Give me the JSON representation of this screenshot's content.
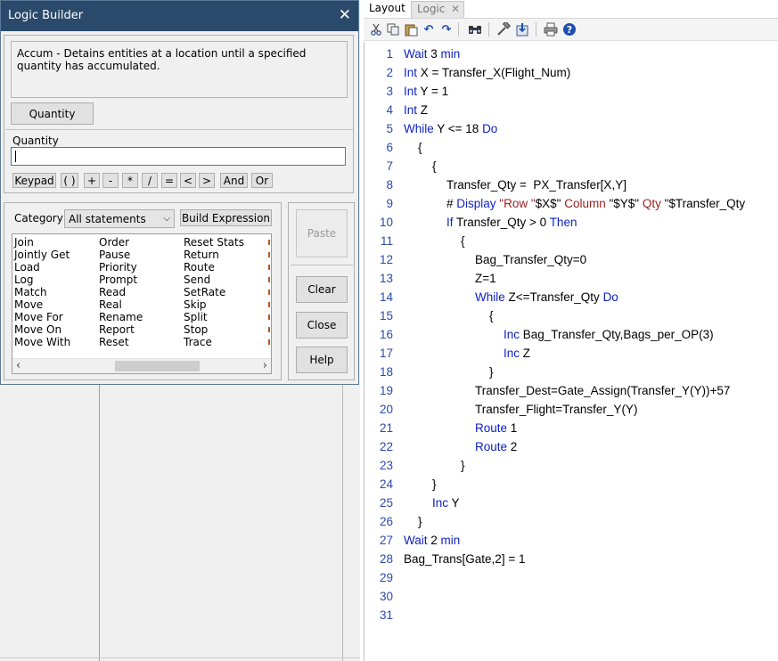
{
  "dialog": {
    "title": "Logic Builder",
    "close_glyph": "✕",
    "description": "Accum - Detains entities at a location until a specified quantity has accumulated.",
    "param_button": "Quantity",
    "quantity_label": "Quantity",
    "quantity_value": "",
    "keypad_buttons": [
      "Keypad",
      "( )",
      "+",
      "-",
      "*",
      "/",
      "=",
      "<",
      ">",
      "And",
      "Or"
    ],
    "category_label": "Category",
    "category_selected": "All statements",
    "build_expression": "Build Expression",
    "side_buttons": {
      "paste": "Paste",
      "clear": "Clear",
      "close": "Close",
      "help": "Help"
    },
    "statements_columns": [
      [
        "Join",
        "Jointly Get",
        "Load",
        "Log",
        "Match",
        "Move",
        "Move For",
        "Move On",
        "Move With"
      ],
      [
        "Order",
        "Pause",
        "Priority",
        "Prompt",
        "Read",
        "Real",
        "Rename",
        "Report",
        "Reset"
      ],
      [
        "Reset Stats",
        "Return",
        "Route",
        "Send",
        "SetRate",
        "Skip",
        "Split",
        "Stop",
        "Trace"
      ]
    ]
  },
  "tabs": [
    {
      "label": "Layout",
      "active": true
    },
    {
      "label": "Logic",
      "active": false,
      "close": "✕"
    }
  ],
  "toolbar": [
    "cut-icon",
    "copy-icon",
    "paste-icon",
    "undo-icon",
    "redo-icon",
    "find-icon",
    "build-icon",
    "import-icon",
    "print-icon",
    "help-icon"
  ],
  "editor": {
    "line_numbers": [
      "1",
      "2",
      "3",
      "4",
      "5",
      "6",
      "7",
      "8",
      "9",
      "10",
      "11",
      "12",
      "13",
      "14",
      "15",
      "16",
      "17",
      "18",
      "19",
      "20",
      "21",
      "22",
      "23",
      "24",
      "25",
      "26",
      "27",
      "28",
      "29",
      "30",
      "31"
    ],
    "lines": [
      [
        {
          "t": "Wait ",
          "k": "kw"
        },
        {
          "t": "3 ",
          "k": ""
        },
        {
          "t": "min",
          "k": "kw"
        }
      ],
      [
        {
          "t": "Int ",
          "k": "kw"
        },
        {
          "t": "X = Transfer_X(Flight_Num)",
          "k": ""
        }
      ],
      [
        {
          "t": "Int ",
          "k": "kw"
        },
        {
          "t": "Y = 1",
          "k": ""
        }
      ],
      [
        {
          "t": "Int ",
          "k": "kw"
        },
        {
          "t": "Z",
          "k": ""
        }
      ],
      [
        {
          "t": "While ",
          "k": "kw"
        },
        {
          "t": "Y <= 18 ",
          "k": ""
        },
        {
          "t": "Do",
          "k": "kw"
        }
      ],
      [
        {
          "t": "{",
          "k": ""
        }
      ],
      [
        {
          "t": "{",
          "k": ""
        }
      ],
      [
        {
          "t": "Transfer_Qty =  PX_Transfer[X,Y]",
          "k": ""
        }
      ],
      [
        {
          "t": "# ",
          "k": ""
        },
        {
          "t": "Display ",
          "k": "kw"
        },
        {
          "t": "\"Row \"",
          "k": "st"
        },
        {
          "t": "$X$\" ",
          "k": ""
        },
        {
          "t": "Column ",
          "k": "st"
        },
        {
          "t": "\"$Y$\" ",
          "k": ""
        },
        {
          "t": "Qty ",
          "k": "st"
        },
        {
          "t": "\"$Transfer_Qty",
          "k": ""
        }
      ],
      [
        {
          "t": "If ",
          "k": "kw"
        },
        {
          "t": "Transfer_Qty > 0 ",
          "k": ""
        },
        {
          "t": "Then",
          "k": "kw"
        }
      ],
      [
        {
          "t": "{",
          "k": ""
        }
      ],
      [
        {
          "t": "Bag_Transfer_Qty=0",
          "k": ""
        }
      ],
      [
        {
          "t": "Z=1",
          "k": ""
        }
      ],
      [
        {
          "t": "While ",
          "k": "kw"
        },
        {
          "t": "Z<=Transfer_Qty ",
          "k": ""
        },
        {
          "t": "Do",
          "k": "kw"
        }
      ],
      [
        {
          "t": "{",
          "k": ""
        }
      ],
      [
        {
          "t": "Inc ",
          "k": "kw"
        },
        {
          "t": "Bag_Transfer_Qty,Bags_per_OP(3)",
          "k": ""
        }
      ],
      [
        {
          "t": "Inc ",
          "k": "kw"
        },
        {
          "t": "Z",
          "k": ""
        }
      ],
      [
        {
          "t": "}",
          "k": ""
        }
      ],
      [
        {
          "t": "Transfer_Dest=Gate_Assign(Transfer_Y(Y))+57",
          "k": ""
        }
      ],
      [
        {
          "t": "Transfer_Flight=Transfer_Y(Y)",
          "k": ""
        }
      ],
      [
        {
          "t": "Route ",
          "k": "kw"
        },
        {
          "t": "1",
          "k": ""
        }
      ],
      [
        {
          "t": "Route ",
          "k": "kw"
        },
        {
          "t": "2",
          "k": ""
        }
      ],
      [
        {
          "t": "}",
          "k": ""
        }
      ],
      [
        {
          "t": "}",
          "k": ""
        }
      ],
      [
        {
          "t": "Inc ",
          "k": "kw"
        },
        {
          "t": "Y",
          "k": ""
        }
      ],
      [
        {
          "t": "}",
          "k": ""
        }
      ],
      [
        {
          "t": "Wait ",
          "k": "kw"
        },
        {
          "t": "2 ",
          "k": ""
        },
        {
          "t": "min",
          "k": "kw"
        }
      ],
      [
        {
          "t": "Bag_Trans[Gate,2] = 1",
          "k": ""
        }
      ],
      [],
      [],
      []
    ]
  }
}
